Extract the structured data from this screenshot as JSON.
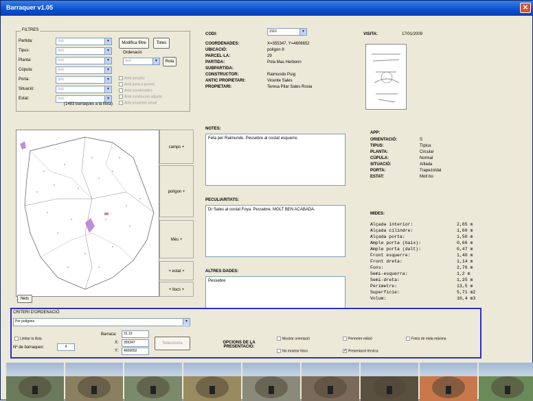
{
  "window": {
    "title": "Barraquer v1.05"
  },
  "filters": {
    "legend": "FILTRES",
    "labels": [
      "Partida:",
      "Tipus:",
      "Planta:",
      "Cúpula:",
      "Porta:",
      "Situació:",
      "Estat:"
    ],
    "combo_value": "(tot)",
    "btn_modify": "Modifica filtre",
    "btn_all": "Totes",
    "ordering_label": "Ordenació",
    "ordering_value": "(tot)",
    "btn_rota": "Rota",
    "checks": [
      "Amb aixopluc",
      "Amb porta a ponent",
      "Amb coordenades",
      "Amb construcció adjunta",
      "Amb propietari actual"
    ],
    "count": "(1483 barraques a la llista)"
  },
  "record": {
    "codi_label": "CODI:",
    "codi_value": "3110",
    "coords_label": "COORDENADES:",
    "coords_value": "X=355347, Y=4606652",
    "ubicacio_label": "UBICACIÓ:",
    "ubicacio_value": "polígon 8",
    "parcela_label": "PARCEL·LA:",
    "parcela_value": "29",
    "partida_label": "PARTIDA:",
    "partida_value": "Pola Mas Herbonn",
    "subpartida_label": "SUBPARTIDA:",
    "subpartida_value": "",
    "constructor_label": "CONSTRUCTOR:",
    "constructor_value": "Raimundo Puig",
    "antic_label": "ANTIC PROPIETARI:",
    "antic_value": "Vicente Sales",
    "propietari_label": "PROPIETARI:",
    "propietari_value": "Teresa Pilar Sales Rosia",
    "visita_label": "VISITA:",
    "visita_value": "17/01/2009"
  },
  "notes": {
    "notes_label": "NOTES:",
    "notes_value": "Feta per Raimundo. Pessebre al costat esquerre.",
    "peculiaritats_label": "PECULIARITATS:",
    "peculiaritats_value": "Dr Sales al costat Foya. Pessebre. MOLT BEN ACABADA.",
    "altres_label": "ALTRES DADES:",
    "altres_value": "Pessebre"
  },
  "app": {
    "app_label": "APP:",
    "rows": [
      {
        "k": "ORIENTACIÓ:",
        "v": "S"
      },
      {
        "k": "TIPUS:",
        "v": "Típica"
      },
      {
        "k": "PLANTA:",
        "v": "Circular"
      },
      {
        "k": "CÚPULA:",
        "v": "Normal"
      },
      {
        "k": "SITUACIÓ:",
        "v": "Aïllada"
      },
      {
        "k": "PORTA:",
        "v": "Trapezoïdal"
      },
      {
        "k": "ESTAT:",
        "v": "Molt bo"
      }
    ]
  },
  "mides": {
    "label": "MIDES:",
    "rows": [
      {
        "k": "Alçada interior:",
        "v": "2,65 m"
      },
      {
        "k": "Alçada cilindre:",
        "v": "1,60 m"
      },
      {
        "k": "Alçada porta:",
        "v": "1,50 m"
      },
      {
        "k": "Ample porta (baix):",
        "v": "0,66 m"
      },
      {
        "k": "Ample porta (dalt):",
        "v": "0,47 m"
      },
      {
        "k": "Front esquerre:",
        "v": "1,40 m"
      },
      {
        "k": "Front dreta:",
        "v": "1,14 m"
      },
      {
        "k": "Fons:",
        "v": "2,76 m"
      },
      {
        "k": "Semi-esquerra:",
        "v": "1,2 m"
      },
      {
        "k": "Semi-dreta:",
        "v": "1,25 m"
      },
      {
        "k": "Perímetre:",
        "v": "13,5 m"
      },
      {
        "k": "Superfície:",
        "v": "5,71 m2"
      },
      {
        "k": "Volum:",
        "v": "10,4 m3"
      }
    ]
  },
  "map_buttons": [
    "camps +",
    "polígon +",
    "Més +",
    "+ estat +",
    "+ llocs +"
  ],
  "map_small_btn": "Nets",
  "criteri": {
    "label": "CRITERI D'ORDENACIÓ",
    "value": "Per polígons",
    "limitar": "Limitar la llista",
    "num_label": "Nº de barraques:",
    "num_value": "4",
    "barraca_label": "Barraca:",
    "barraca_value": "31.10",
    "x_label": "X:",
    "x_value": "355347",
    "y_label": "Y:",
    "y_value": "4606652",
    "ok_btn": "Selecciona",
    "opcions_label": "OPCIONS DE LA PRESENTACIÓ:",
    "opt1": "Mostrar orientació",
    "opt2": "Permetre edició",
    "opt3": "Fotos de mida màxima",
    "opt4": "No mostrar fotos",
    "opt5": "Presentació tècnica"
  },
  "photos": [
    "#6b7a5a",
    "#8a8060",
    "#7a8a6a",
    "#9a8a60",
    "#8a8a7a",
    "#7a6a5a",
    "#5a5040",
    "#c8784a",
    "#6a8a5a"
  ]
}
